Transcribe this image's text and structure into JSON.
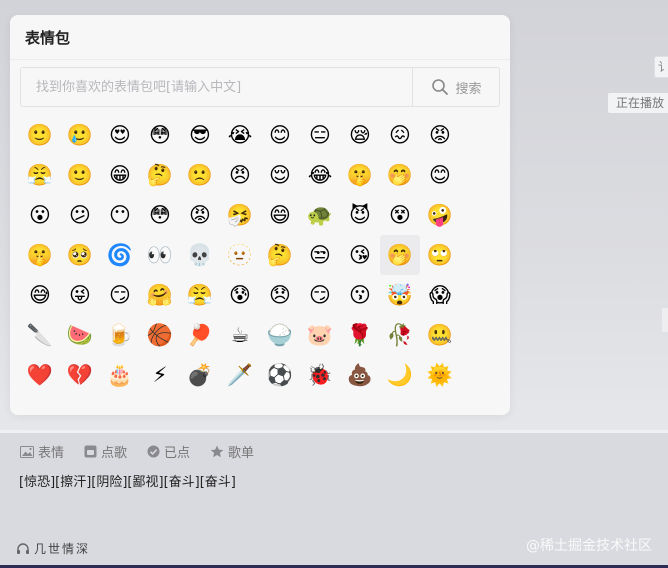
{
  "panel": {
    "title": "表情包",
    "search": {
      "placeholder": "找到你喜欢的表情包吧[请输入中文]",
      "button_label": "搜索"
    }
  },
  "emojis": [
    [
      "🙂",
      "🥲",
      "😍",
      "😳",
      "😎",
      "😭",
      "😊",
      "😑",
      "😪",
      "😖",
      "😡"
    ],
    [
      "😤",
      "🙂",
      "😁",
      "🤔",
      "🙁",
      "😠",
      "😌",
      "😂",
      "🤫",
      "🤭",
      "😊"
    ],
    [
      "😮",
      "😕",
      "😶",
      "😳",
      "😡",
      "🤧",
      "😄",
      "🐢",
      "😈",
      "😵",
      "🤪"
    ],
    [
      "🤫",
      "🥺",
      "🌀",
      "👀",
      "💀",
      "🫥",
      "🤔",
      "😒",
      "😘",
      "🤭",
      "🙄"
    ],
    [
      "😅",
      "😜",
      "😏",
      "🤗",
      "😤",
      "😰",
      "😞",
      "😏",
      "😗",
      "🤯",
      "😱"
    ],
    [
      "🔪",
      "🍉",
      "🍺",
      "🏀",
      "🏓",
      "☕",
      "🍚",
      "🐷",
      "🌹",
      "🥀",
      "🤐"
    ],
    [
      "❤️",
      "💔",
      "🎂",
      "⚡",
      "💣",
      "🗡️",
      "⚽",
      "🐞",
      "💩",
      "🌙",
      "🌞"
    ]
  ],
  "highlighted": {
    "row": 3,
    "col": 9
  },
  "toolbar": [
    {
      "icon": "image-icon",
      "label": "表情"
    },
    {
      "icon": "music-icon",
      "label": "点歌"
    },
    {
      "icon": "check-icon",
      "label": "已点"
    },
    {
      "icon": "star-icon",
      "label": "歌单"
    }
  ],
  "message": "[惊恐][擦汗][阴险][鄙视][奋斗][奋斗]",
  "user": "几世情深",
  "watermark": "@稀土掘金技术社区",
  "background": {
    "right_chip": "讠",
    "playing_label": "正在播放"
  },
  "colors": {
    "panel_bg": "#f7f7f8",
    "backdrop": "#d6d7db",
    "bottom_edge": "#2b2d55"
  }
}
